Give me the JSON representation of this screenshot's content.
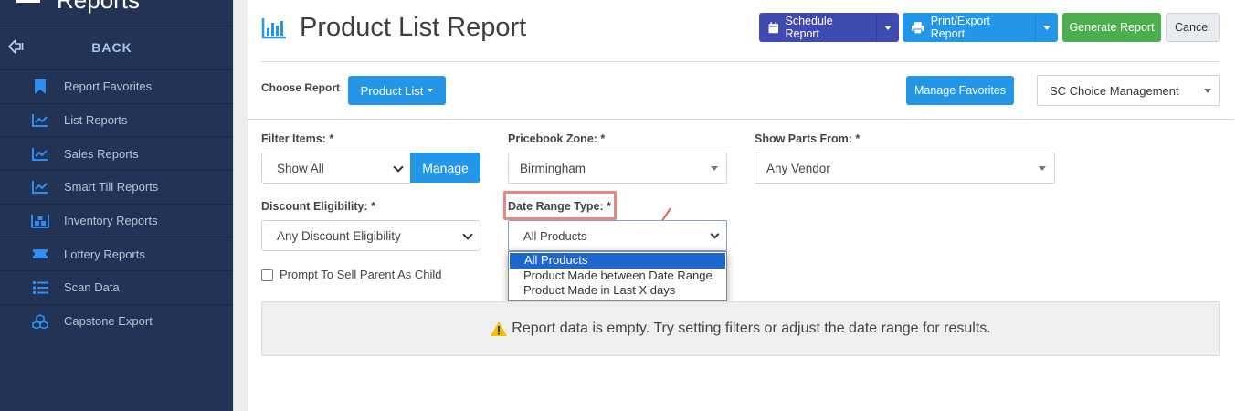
{
  "sidebar": {
    "title": "Reports",
    "back_label": "BACK",
    "items": [
      {
        "label": "Report Favorites",
        "icon": "bookmark-icon"
      },
      {
        "label": "List Reports",
        "icon": "line-chart-icon"
      },
      {
        "label": "Sales Reports",
        "icon": "line-chart-icon"
      },
      {
        "label": "Smart Till Reports",
        "icon": "line-chart-icon"
      },
      {
        "label": "Inventory Reports",
        "icon": "warehouse-icon"
      },
      {
        "label": "Lottery Reports",
        "icon": "ticket-icon"
      },
      {
        "label": "Scan Data",
        "icon": "list-icon"
      },
      {
        "label": "Capstone Export",
        "icon": "cubes-icon"
      }
    ]
  },
  "header": {
    "title": "Product List Report",
    "title_icon": "bar-chart-icon"
  },
  "toolbar": {
    "schedule_label": "Schedule Report",
    "print_label": "Print/Export Report",
    "generate_label": "Generate Report",
    "cancel_label": "Cancel"
  },
  "choose": {
    "label": "Choose Report",
    "report_button": "Product List",
    "manage_favorites": "Manage Favorites",
    "company_value": "SC Choice Management"
  },
  "filters": {
    "filter_items": {
      "label": "Filter Items: *",
      "value": "Show All",
      "manage_label": "Manage"
    },
    "pricebook_zone": {
      "label": "Pricebook Zone: *",
      "value": "Birmingham"
    },
    "show_parts_from": {
      "label": "Show Parts From: *",
      "value": "Any Vendor"
    },
    "discount_eligibility": {
      "label": "Discount Eligibility: *",
      "value": "Any Discount Eligibility"
    },
    "date_range_type": {
      "label": "Date Range Type: *",
      "value": "All Products",
      "options": [
        "All Products",
        "Product Made between Date Range",
        "Product Made in Last X days"
      ],
      "selected_index": 0
    },
    "prompt_parent": {
      "label": "Prompt To Sell Parent As Child",
      "checked": false
    }
  },
  "empty_message": "Report data is empty. Try setting filters or adjust the date range for results.",
  "colors": {
    "sidebar_bg": "#233356",
    "primary": "#2496e8",
    "schedule": "#3f4bb0",
    "success": "#4cae4c",
    "annotation": "#e9867e",
    "warning": "#f2c200"
  }
}
